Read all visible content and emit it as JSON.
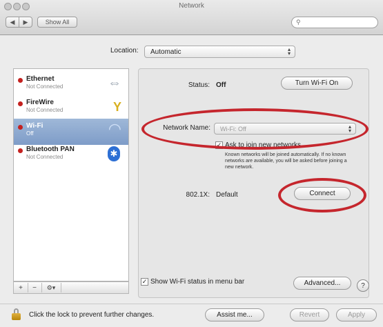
{
  "window": {
    "title": "Network",
    "nav_back": "◀",
    "nav_forward": "▶",
    "show_all": "Show All",
    "search_icon": "magnifier-icon"
  },
  "location": {
    "label": "Location:",
    "value": "Automatic"
  },
  "sidebar": {
    "items": [
      {
        "name": "Ethernet",
        "status": "Not Connected",
        "icon": "⇔",
        "icon_name": "ethernet-arrows-icon",
        "dot_color": "#c4211f"
      },
      {
        "name": "FireWire",
        "status": "Not Connected",
        "icon": "Y",
        "icon_name": "firewire-icon",
        "dot_color": "#c4211f"
      },
      {
        "name": "Wi-Fi",
        "status": "Off",
        "icon": "◠",
        "icon_name": "wifi-icon",
        "dot_color": "#c4211f",
        "selected": true
      },
      {
        "name": "Bluetooth PAN",
        "status": "Not Connected",
        "icon": "✱",
        "icon_name": "bluetooth-icon",
        "dot_color": "#c4211f"
      }
    ],
    "tools": {
      "add": "+",
      "remove": "−",
      "action": "⚙▾"
    }
  },
  "main": {
    "status_label": "Status:",
    "status_value": "Off",
    "turn_wifi_button": "Turn Wi-Fi On",
    "network_name_label": "Network Name:",
    "network_name_value": "Wi-Fi: Off",
    "ask_checkbox_label": "Ask to join new networks",
    "ask_help_text": "Known networks will be joined automatically. If no known networks are available, you will be asked before joining a new network.",
    "dot1x_label": "802.1X:",
    "dot1x_value": "Default",
    "connect_button": "Connect",
    "show_status_label": "Show Wi-Fi status in menu bar",
    "advanced_button": "Advanced...",
    "help_button": "?"
  },
  "footer": {
    "lock_text": "Click the lock to prevent further changes.",
    "assist_button": "Assist me...",
    "revert_button": "Revert",
    "apply_button": "Apply"
  },
  "colors": {
    "annotation_red": "#c5262d",
    "status_dot_red": "#c4211f",
    "selection_blue": "#8aa6cf"
  }
}
